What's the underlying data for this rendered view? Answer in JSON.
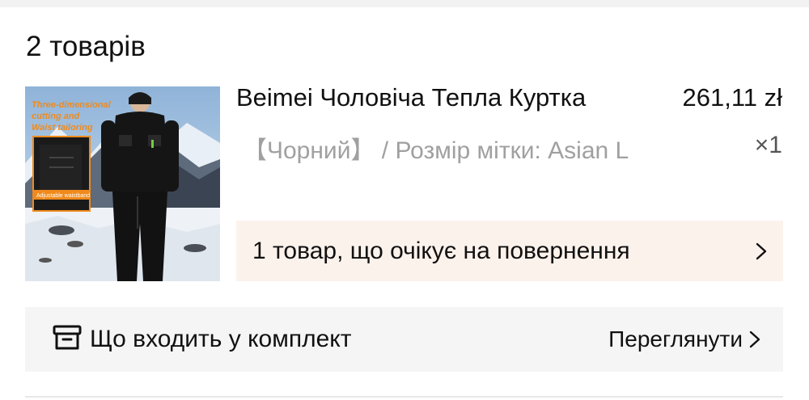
{
  "order": {
    "count_label": "2 товарів"
  },
  "item": {
    "image_text": {
      "line1": "Three-dimensional",
      "line2": "cutting and",
      "line3": "Waist tailoring",
      "badge": "Adjustable waistband"
    },
    "title": "Beimei Чоловіча Тепла Куртка",
    "price": "261,11 zł",
    "variant": "【Чорний】 / Розмір мітки: Asian L",
    "quantity": "×1"
  },
  "return_banner": {
    "label": "1 товар, що очікує на повернення",
    "icon": "chevron-right-icon"
  },
  "bundle": {
    "icon": "box-icon",
    "label": "Що входить у комплект",
    "view_label": "Переглянути",
    "view_icon": "chevron-right-icon"
  },
  "colors": {
    "banner_bg": "#fcf2ec",
    "bundle_bg": "#f5f5f5",
    "muted_text": "#a0a0a0"
  }
}
